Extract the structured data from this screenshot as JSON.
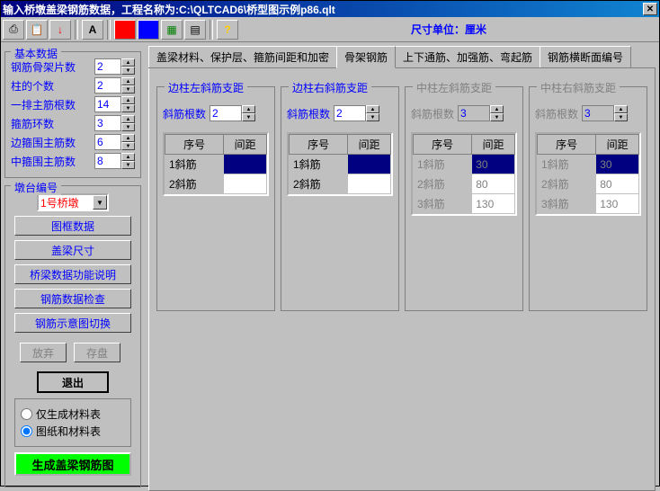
{
  "title": "输入桥墩盖梁钢筋数据，工程名称为:C:\\QLTCAD6\\桥型图示例p86.qlt",
  "toolbar": {
    "unit": "尺寸单位：厘米"
  },
  "basic": {
    "legend": "基本数据",
    "fields": [
      {
        "label": "钢筋骨架片数",
        "value": "2"
      },
      {
        "label": "柱的个数",
        "value": "2"
      },
      {
        "label": "一排主筋根数",
        "value": "14"
      },
      {
        "label": "箍筋环数",
        "value": "3"
      },
      {
        "label": "边箍围主筋数",
        "value": "6"
      },
      {
        "label": "中箍围主筋数",
        "value": "8"
      }
    ]
  },
  "pier": {
    "legend": "墩台编号",
    "value": "1号桥墩"
  },
  "buttons": {
    "b1": "图框数据",
    "b2": "盖梁尺寸",
    "b3": "桥梁数据功能说明",
    "b4": "钢筋数据检查",
    "b5": "钢筋示意图切换",
    "abandon": "放弃",
    "save": "存盘",
    "exit": "退出"
  },
  "radios": {
    "r1": "仅生成材料表",
    "r2": "图纸和材料表"
  },
  "generate": "生成盖梁钢筋图",
  "tabs": [
    "盖梁材料、保护层、箍筋间距和加密",
    "骨架钢筋",
    "上下通筋、加强筋、弯起筋",
    "钢筋横断面编号"
  ],
  "panels": [
    {
      "title": "边柱左斜筋支距",
      "label": "斜筋根数",
      "count": "2",
      "header": [
        "序号",
        "间距"
      ],
      "rows": [
        [
          "1斜筋",
          ""
        ],
        [
          "2斜筋",
          ""
        ]
      ],
      "disabled": false
    },
    {
      "title": "边柱右斜筋支距",
      "label": "斜筋根数",
      "count": "2",
      "header": [
        "序号",
        "间距"
      ],
      "rows": [
        [
          "1斜筋",
          ""
        ],
        [
          "2斜筋",
          ""
        ]
      ],
      "disabled": false
    },
    {
      "title": "中柱左斜筋支距",
      "label": "斜筋根数",
      "count": "3",
      "header": [
        "序号",
        "间距"
      ],
      "rows": [
        [
          "1斜筋",
          "30"
        ],
        [
          "2斜筋",
          "80"
        ],
        [
          "3斜筋",
          "130"
        ]
      ],
      "disabled": true
    },
    {
      "title": "中柱右斜筋支距",
      "label": "斜筋根数",
      "count": "3",
      "header": [
        "序号",
        "间距"
      ],
      "rows": [
        [
          "1斜筋",
          "30"
        ],
        [
          "2斜筋",
          "80"
        ],
        [
          "3斜筋",
          "130"
        ]
      ],
      "disabled": true
    }
  ]
}
